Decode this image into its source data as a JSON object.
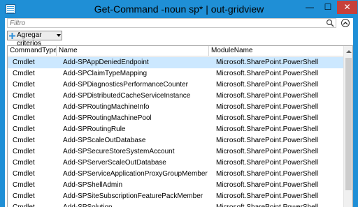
{
  "window": {
    "title": "Get-Command -noun sp* | out-gridview",
    "minimize_glyph": "—",
    "maximize_glyph": "☐",
    "close_glyph": "✕"
  },
  "filter": {
    "placeholder": "Filtro"
  },
  "criteria_button": {
    "label": "Agregar criterios"
  },
  "grid": {
    "columns": [
      "CommandType",
      "Name",
      "ModuleName"
    ],
    "rows": [
      [
        "Cmdlet",
        "Add-SPAppDeniedEndpoint",
        "Microsoft.SharePoint.PowerShell"
      ],
      [
        "Cmdlet",
        "Add-SPClaimTypeMapping",
        "Microsoft.SharePoint.PowerShell"
      ],
      [
        "Cmdlet",
        "Add-SPDiagnosticsPerformanceCounter",
        "Microsoft.SharePoint.PowerShell"
      ],
      [
        "Cmdlet",
        "Add-SPDistributedCacheServiceInstance",
        "Microsoft.SharePoint.PowerShell"
      ],
      [
        "Cmdlet",
        "Add-SPRoutingMachineInfo",
        "Microsoft.SharePoint.PowerShell"
      ],
      [
        "Cmdlet",
        "Add-SPRoutingMachinePool",
        "Microsoft.SharePoint.PowerShell"
      ],
      [
        "Cmdlet",
        "Add-SPRoutingRule",
        "Microsoft.SharePoint.PowerShell"
      ],
      [
        "Cmdlet",
        "Add-SPScaleOutDatabase",
        "Microsoft.SharePoint.PowerShell"
      ],
      [
        "Cmdlet",
        "Add-SPSecureStoreSystemAccount",
        "Microsoft.SharePoint.PowerShell"
      ],
      [
        "Cmdlet",
        "Add-SPServerScaleOutDatabase",
        "Microsoft.SharePoint.PowerShell"
      ],
      [
        "Cmdlet",
        "Add-SPServiceApplicationProxyGroupMember",
        "Microsoft.SharePoint.PowerShell"
      ],
      [
        "Cmdlet",
        "Add-SPShellAdmin",
        "Microsoft.SharePoint.PowerShell"
      ],
      [
        "Cmdlet",
        "Add-SPSiteSubscriptionFeaturePackMember",
        "Microsoft.SharePoint.PowerShell"
      ],
      [
        "Cmdlet",
        "Add-SPSolution",
        "Microsoft.SharePoint.PowerShell"
      ]
    ]
  },
  "colors": {
    "titlebar": "#1f8fd6",
    "close_button": "#c7403a",
    "selected_row": "#cce8ff"
  },
  "icons": [
    "app-icon",
    "search-icon",
    "collapse-icon",
    "plus-icon",
    "dropdown-arrow-icon",
    "scroll-up-icon"
  ]
}
